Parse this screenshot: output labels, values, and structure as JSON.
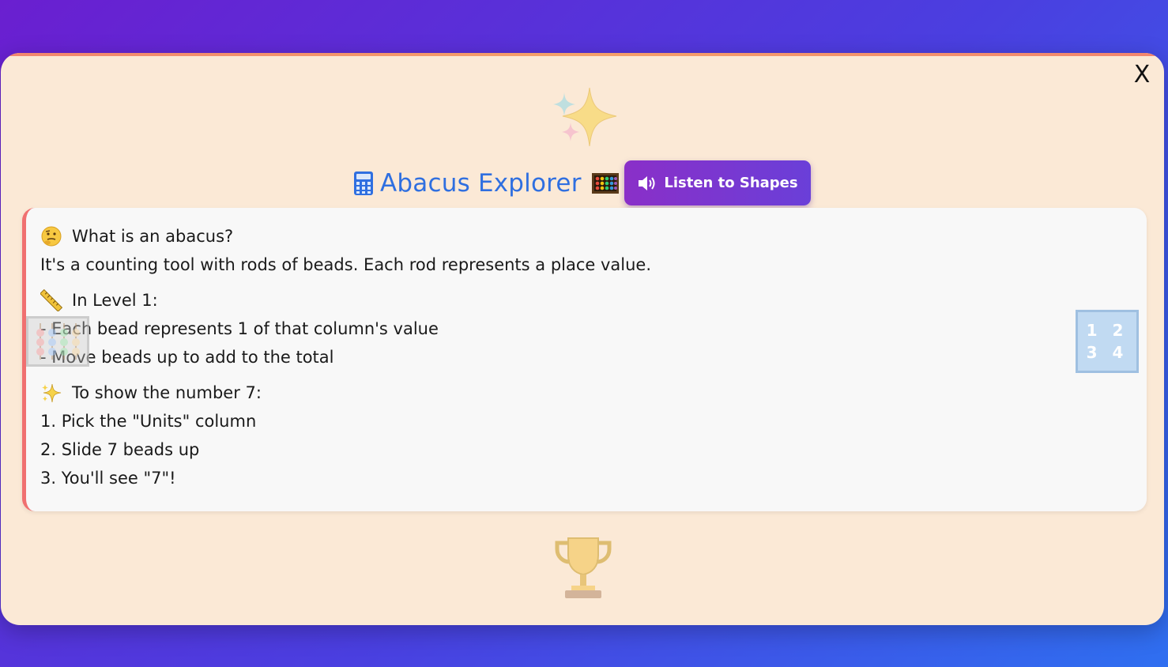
{
  "modal": {
    "close_label": "X",
    "title": "Abacus Explorer",
    "listen_button": "Listen to Shapes"
  },
  "card": {
    "what_heading": "What is an abacus?",
    "what_text": "It's a counting tool with rods of beads. Each rod represents a place value.",
    "level_heading": "In Level 1:",
    "level_items": [
      "- Each bead represents 1 of that column's value",
      "- Move beads up to add to the total"
    ],
    "show_heading": "To show the number 7:",
    "steps": [
      "1. Pick the \"Units\" column",
      "2. Slide 7 beads up",
      "3. You'll see \"7\"!"
    ]
  },
  "decorations": {
    "number_tile_row1": "1 2",
    "number_tile_row2": "3 4"
  },
  "icons": {
    "sparkle": "sparkles-icon",
    "calculator": "calculator-icon",
    "abacus": "abacus-icon",
    "speaker": "speaker-icon",
    "thinking": "thinking-face-icon",
    "ruler": "ruler-icon",
    "trophy": "trophy-icon"
  },
  "colors": {
    "background_start": "#6a1fd0",
    "background_end": "#2f6ff0",
    "modal_bg": "#fbe9d6",
    "title": "#2f6fe0",
    "listen_button": "#8a2fc8",
    "card_accent": "#f07070"
  }
}
